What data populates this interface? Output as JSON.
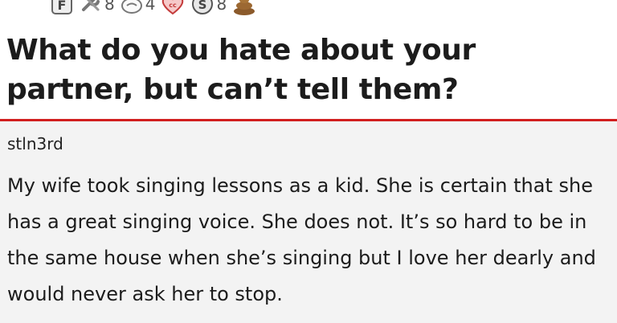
{
  "awards": [
    {
      "icon": "award-f-icon",
      "count": ""
    },
    {
      "icon": "award-wrench-icon",
      "count": "8"
    },
    {
      "icon": "award-hand-icon",
      "count": "4"
    },
    {
      "icon": "award-heart-cc-icon",
      "count": ""
    },
    {
      "icon": "award-s-coin-icon",
      "count": "8"
    },
    {
      "icon": "award-poop-icon",
      "count": ""
    }
  ],
  "post": {
    "title": "What do you hate about your partner, but can’t tell them?"
  },
  "comment": {
    "username": "stln3rd",
    "body": "My wife took singing lessons as a kid. She is certain that she has a great singing voice. She does not. It’s so hard to be in the same house when she’s singing but I love her dearly and would never ask her to stop."
  },
  "colors": {
    "divider": "#d11f1f",
    "comment_background": "#f3f3f3"
  }
}
